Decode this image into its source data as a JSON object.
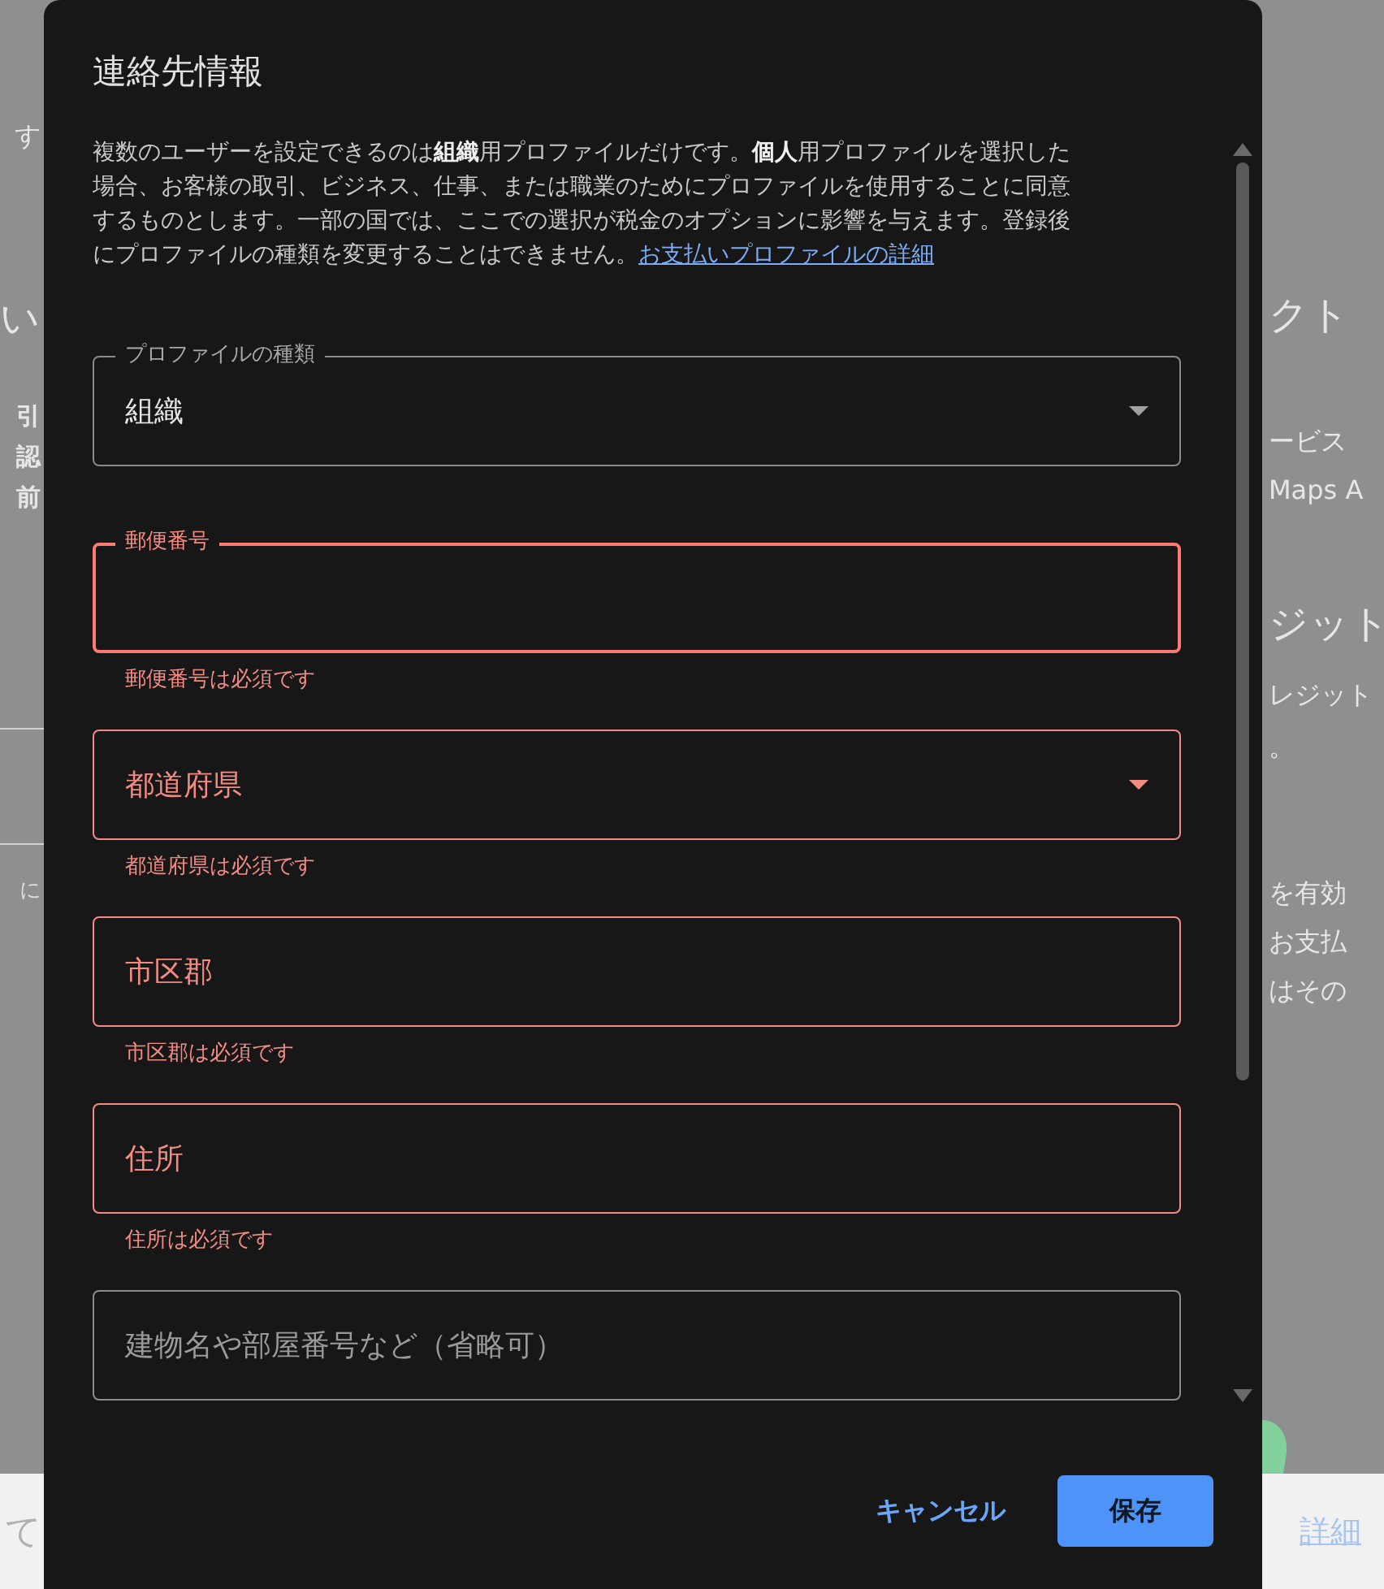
{
  "background": {
    "left_texts": [
      {
        "text": "す",
        "kind": "body"
      },
      {
        "text": "い",
        "kind": "heading"
      },
      {
        "text": "引",
        "kind": "bold"
      },
      {
        "text": "認",
        "kind": "bold"
      },
      {
        "text": "前",
        "kind": "bold"
      },
      {
        "text": "に",
        "kind": "small"
      }
    ],
    "right_texts": [
      {
        "text": "クト",
        "kind": "heading"
      },
      {
        "text": "ービス",
        "kind": "body"
      },
      {
        "text": "Maps A",
        "kind": "body"
      },
      {
        "text": "ジット",
        "kind": "heading"
      },
      {
        "text": "レジット",
        "kind": "body"
      },
      {
        "text": "。",
        "kind": "body"
      },
      {
        "text": "を有効",
        "kind": "body"
      },
      {
        "text": "お支払",
        "kind": "body"
      },
      {
        "text": "はその",
        "kind": "body"
      }
    ],
    "footer_text": "て",
    "footer_link": "詳細"
  },
  "dialog": {
    "title": "連絡先情報",
    "description": "複数のユーザーを設定できるのは**組織**用プロファイルだけです。**個人**用プロファイルを選択した場合、お客様の取引、ビジネス、仕事、または職業のためにプロファイルを使用することに同意するものとします。一部の国では、ここでの選択が税金のオプションに影響を与えます。登録後にプロファイルの種類を変更することはできません。",
    "link": "お支払いプロファイルの詳細",
    "fields": [
      {
        "kind": "select",
        "label": "プロファイルの種類",
        "value": "組織",
        "focused": false,
        "error": false
      },
      {
        "kind": "text",
        "label": "郵便番号",
        "focused": true,
        "error": true,
        "error_text": "郵便番号は必須です"
      },
      {
        "kind": "select",
        "label": "都道府県",
        "focused": false,
        "error": true,
        "error_text": "都道府県は必須です"
      },
      {
        "kind": "text",
        "label": "市区郡",
        "focused": false,
        "error": true,
        "error_text": "市区郡は必須です"
      },
      {
        "kind": "text",
        "label": "住所",
        "focused": false,
        "error": true,
        "error_text": "住所は必須です"
      },
      {
        "kind": "text",
        "placeholder": "建物名や部屋番号など（省略可）",
        "focused": false,
        "error": false
      }
    ],
    "buttons": [
      {
        "label": "キャンセル",
        "kind": "text"
      },
      {
        "label": "保存",
        "kind": "filled"
      }
    ]
  }
}
